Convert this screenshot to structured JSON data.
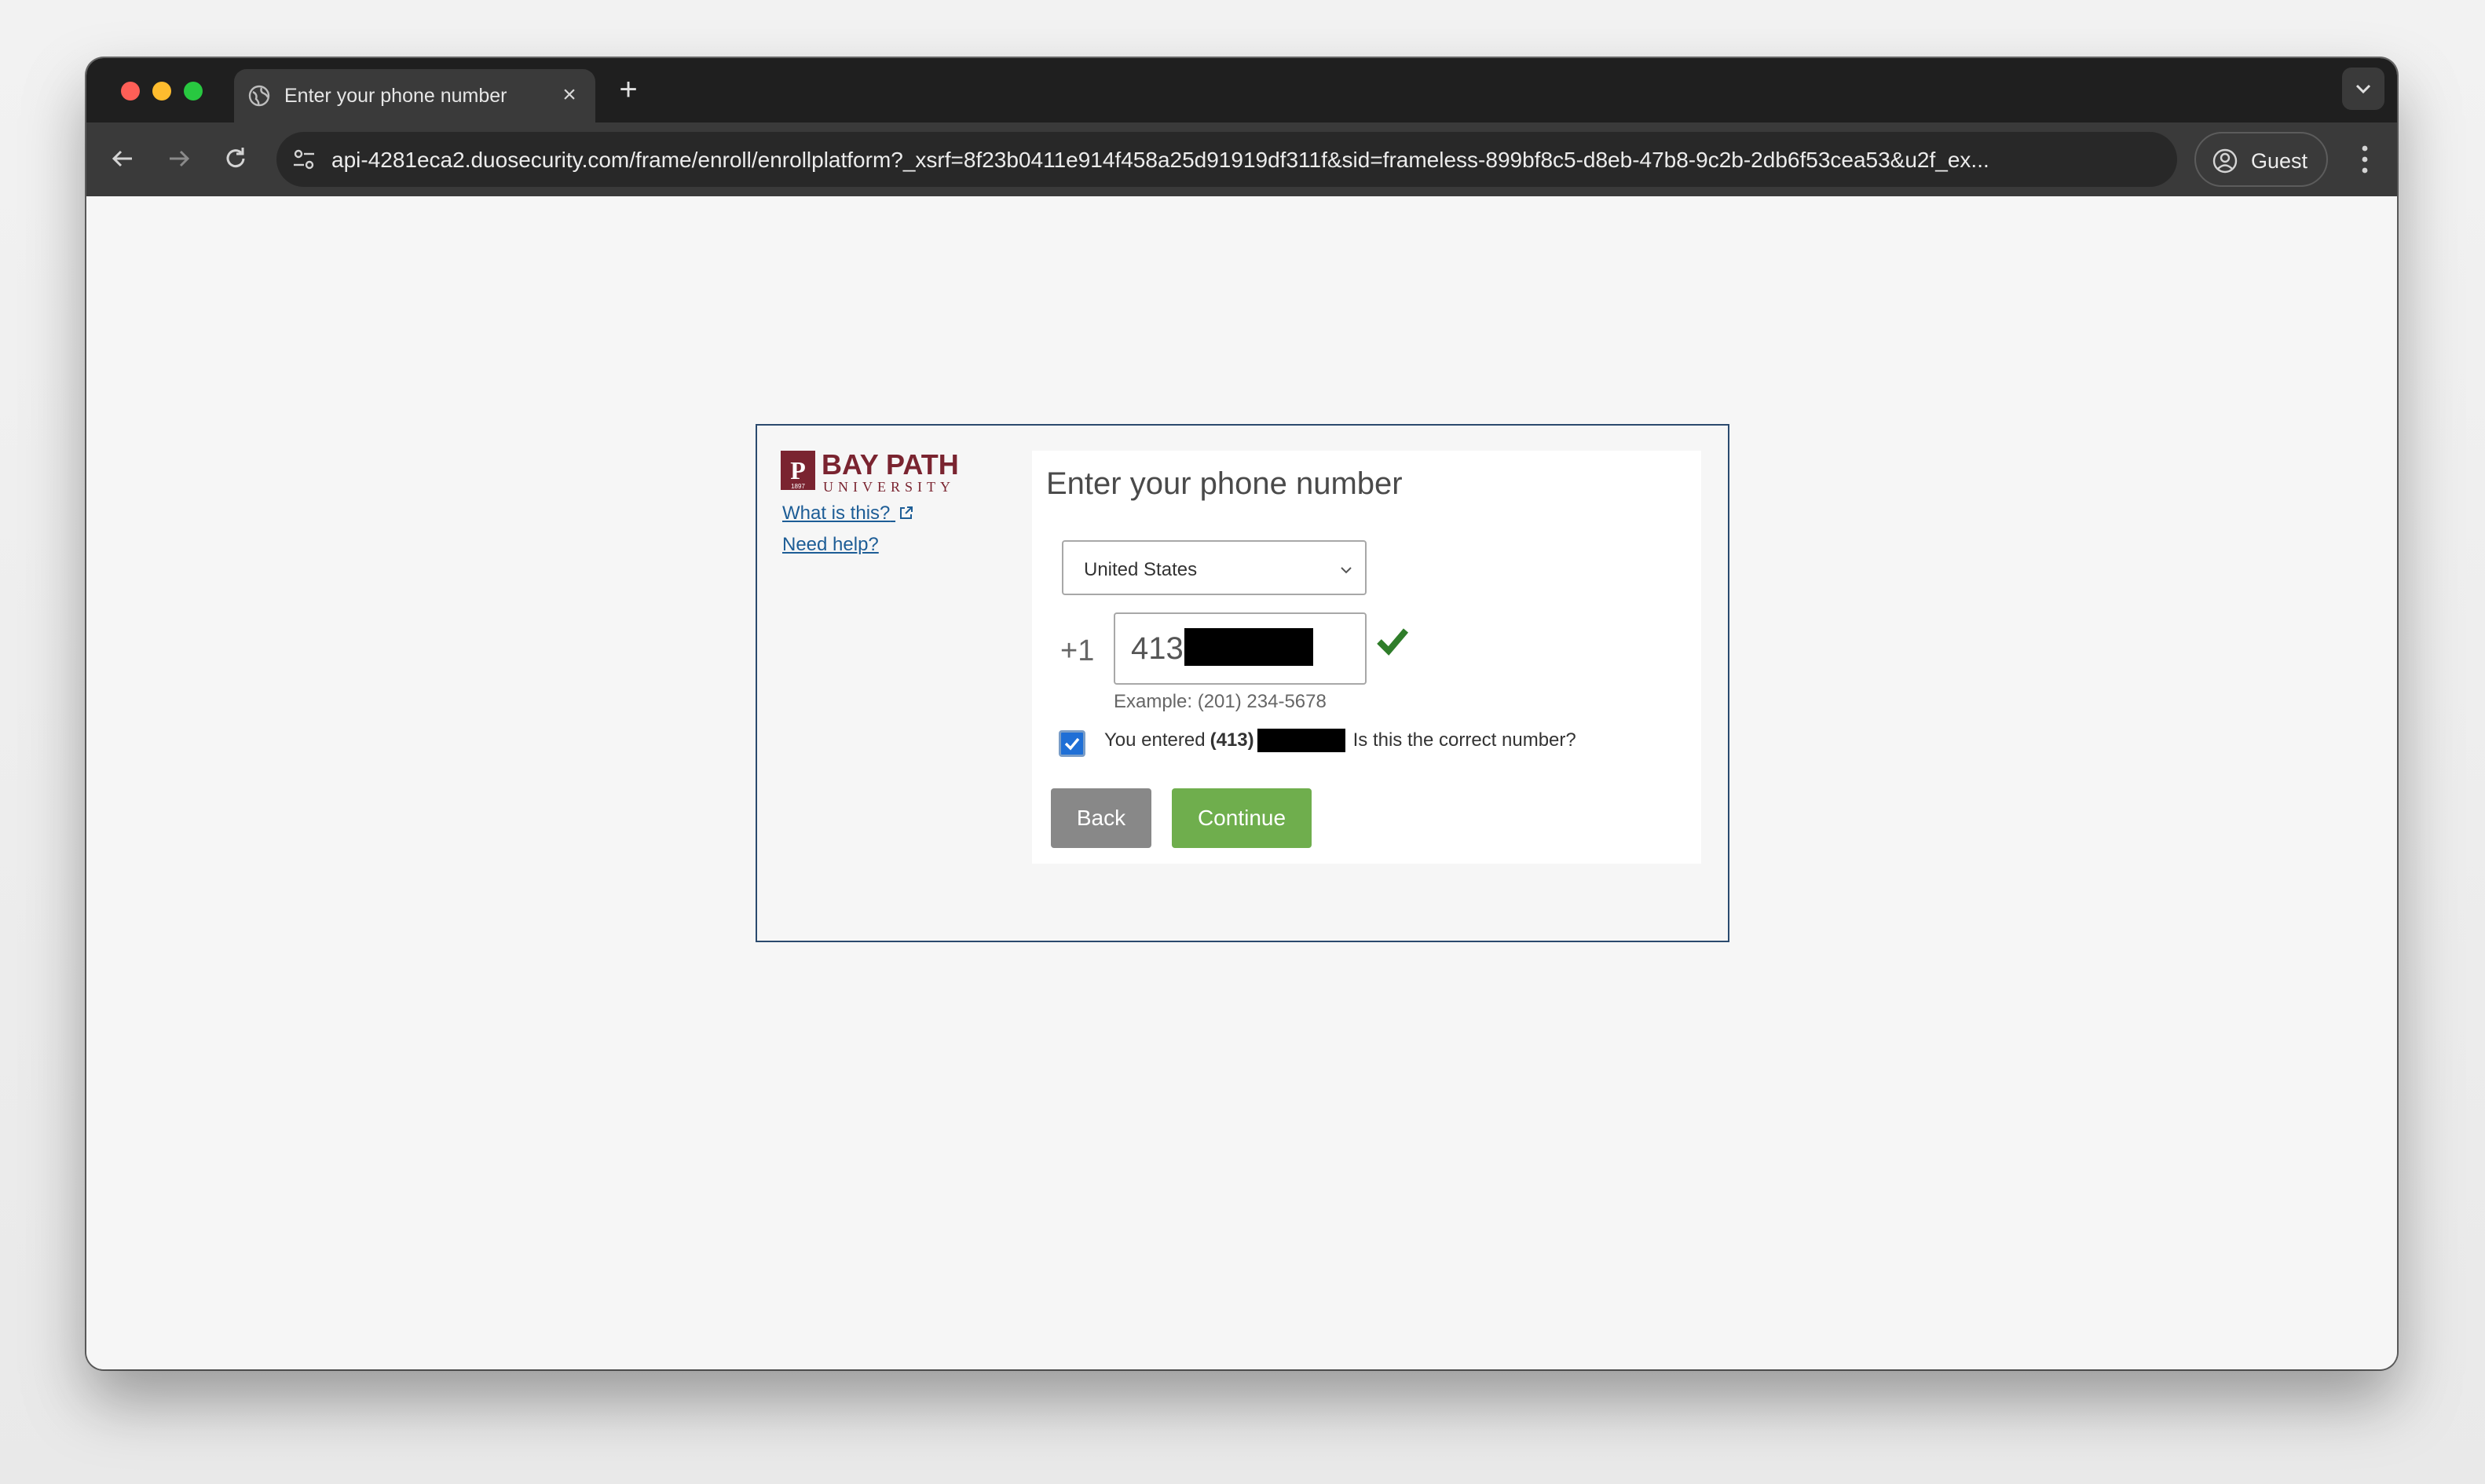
{
  "browser": {
    "tab_title": "Enter your phone number",
    "url": "api-4281eca2.duosecurity.com/frame/enroll/enrollplatform?_xsrf=8f23b0411e914f458a25d91919df311f&sid=frameless-899bf8c5-d8eb-47b8-9c2b-2db6f53cea53&u2f_ex...",
    "profile_label": "Guest",
    "icons": {
      "favicon": "globe-icon",
      "close_tab": "close-icon",
      "new_tab": "plus-icon",
      "tab_menu": "chevron-down-icon",
      "back": "arrow-left-icon",
      "forward": "arrow-right-icon",
      "reload": "reload-icon",
      "site_info": "tune-icon",
      "profile": "person-circle-icon",
      "menu": "kebab-menu-icon"
    }
  },
  "sidebar": {
    "logo_text": "BAY PATH",
    "logo_subtext": "UNIVERSITY",
    "logo_badge": "1897",
    "what_is_this": "What is this?",
    "need_help": "Need help?"
  },
  "form": {
    "heading": "Enter your phone number",
    "country": "United States",
    "country_code": "+1",
    "phone_prefix": "413",
    "example": "Example: (201) 234-5678",
    "confirm_prefix": "You entered",
    "confirm_area": "(413)",
    "confirm_suffix": "Is this the correct number?",
    "confirm_checked": true,
    "back_label": "Back",
    "continue_label": "Continue"
  },
  "colors": {
    "brand": "#7a2430",
    "link": "#1d5d96",
    "continue_button": "#6fae4d",
    "back_button": "#888888",
    "checkmark": "#2f7d2a"
  }
}
